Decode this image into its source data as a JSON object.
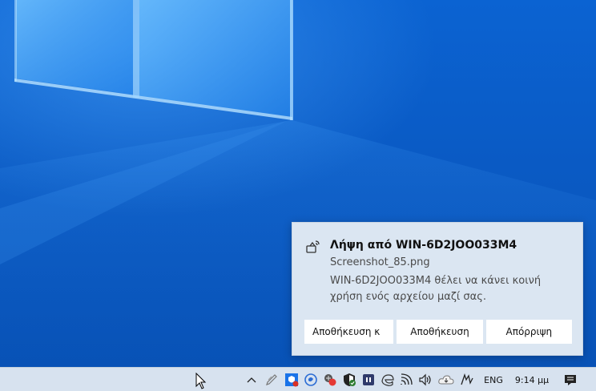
{
  "toast": {
    "title": "Λήψη από WIN-6D2JOO033M4",
    "file_name": "Screenshot_85.png",
    "message": "WIN-6D2JOO033M4 θέλει να κάνει κοινή χρήση ενός αρχείου μαζί σας.",
    "icon": "nearby-share-icon",
    "buttons": {
      "save_open": "Αποθήκευση κ",
      "save": "Αποθήκευση",
      "decline": "Απόρριψη"
    }
  },
  "taskbar": {
    "tray_icons": [
      "chevron-up-icon",
      "pen-icon",
      "defender-icon",
      "skype-icon",
      "security-alert-icon",
      "windows-security-icon",
      "app-tile-icon",
      "edge-icon",
      "network-icon",
      "volume-icon",
      "onedrive-icon",
      "handwriting-icon"
    ],
    "language": "ENG",
    "clock": "9:14 μμ",
    "action_center_icon": "notification-center-icon"
  },
  "colors": {
    "desktop_blue": "#0a5cc6",
    "toast_bg": "#dbe6f2",
    "taskbar_bg": "#d7e2ef"
  }
}
